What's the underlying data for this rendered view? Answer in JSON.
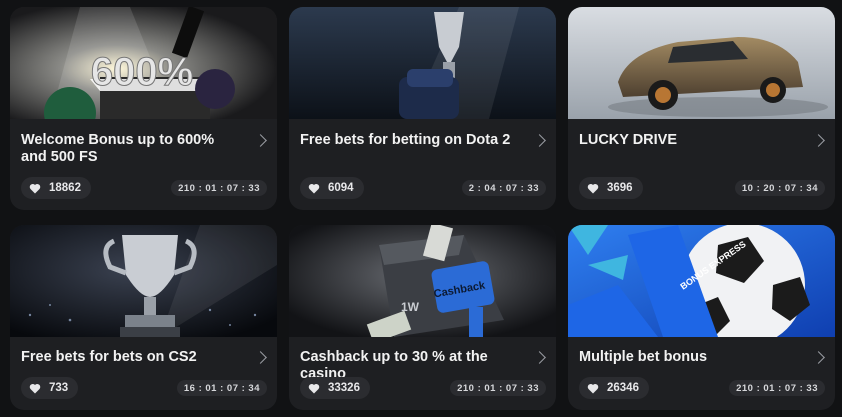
{
  "promos": [
    {
      "title": "Welcome Bonus up to 600% and 500 FS",
      "likes": "18862",
      "timer": "210 : 01 : 07 : 33",
      "banner_text": "600%",
      "icon": "heart-icon"
    },
    {
      "title": "Free bets for betting on Dota 2",
      "likes": "6094",
      "timer": "2 : 04 : 07 : 33",
      "icon": "heart-icon"
    },
    {
      "title": "LUCKY DRIVE",
      "likes": "3696",
      "timer": "10 : 20 : 07 : 34",
      "icon": "heart-icon"
    },
    {
      "title": "Free bets for bets on CS2",
      "likes": "733",
      "timer": "16 : 01 : 07 : 34",
      "icon": "heart-icon"
    },
    {
      "title": "Cashback up to 30 % at the casino",
      "likes": "33326",
      "timer": "210 : 01 : 07 : 33",
      "banner_text": "Cashback",
      "banner_logo": "1W",
      "icon": "heart-icon"
    },
    {
      "title": "Multiple bet bonus",
      "likes": "26346",
      "timer": "210 : 01 : 07 : 33",
      "banner_text": "BONUS EXPRESS",
      "icon": "heart-icon"
    }
  ],
  "colors": {
    "page_bg": "#111214",
    "card_bg": "#1e1f22",
    "pill_bg": "#2b2c30",
    "accent_blue": "#2b6bd6"
  }
}
